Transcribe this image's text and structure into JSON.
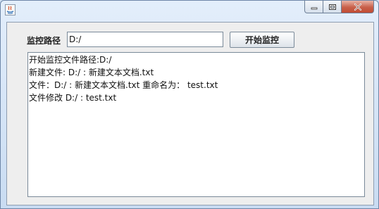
{
  "window": {
    "title": "",
    "buttons": {
      "minimize_icon": "minimize-icon",
      "maximize_icon": "maximize-icon",
      "close_icon": "close-icon"
    }
  },
  "form": {
    "path_label": "监控路径",
    "path_value": "D:/",
    "start_button_label": "开始监控"
  },
  "log": {
    "lines": [
      "开始监控文件路径:D:/",
      "新建文件: D:/ : 新建文本文档.txt",
      "文件：D:/ : 新建文本文档.txt 重命名为： test.txt",
      "文件修改 D:/ : test.txt"
    ]
  }
}
